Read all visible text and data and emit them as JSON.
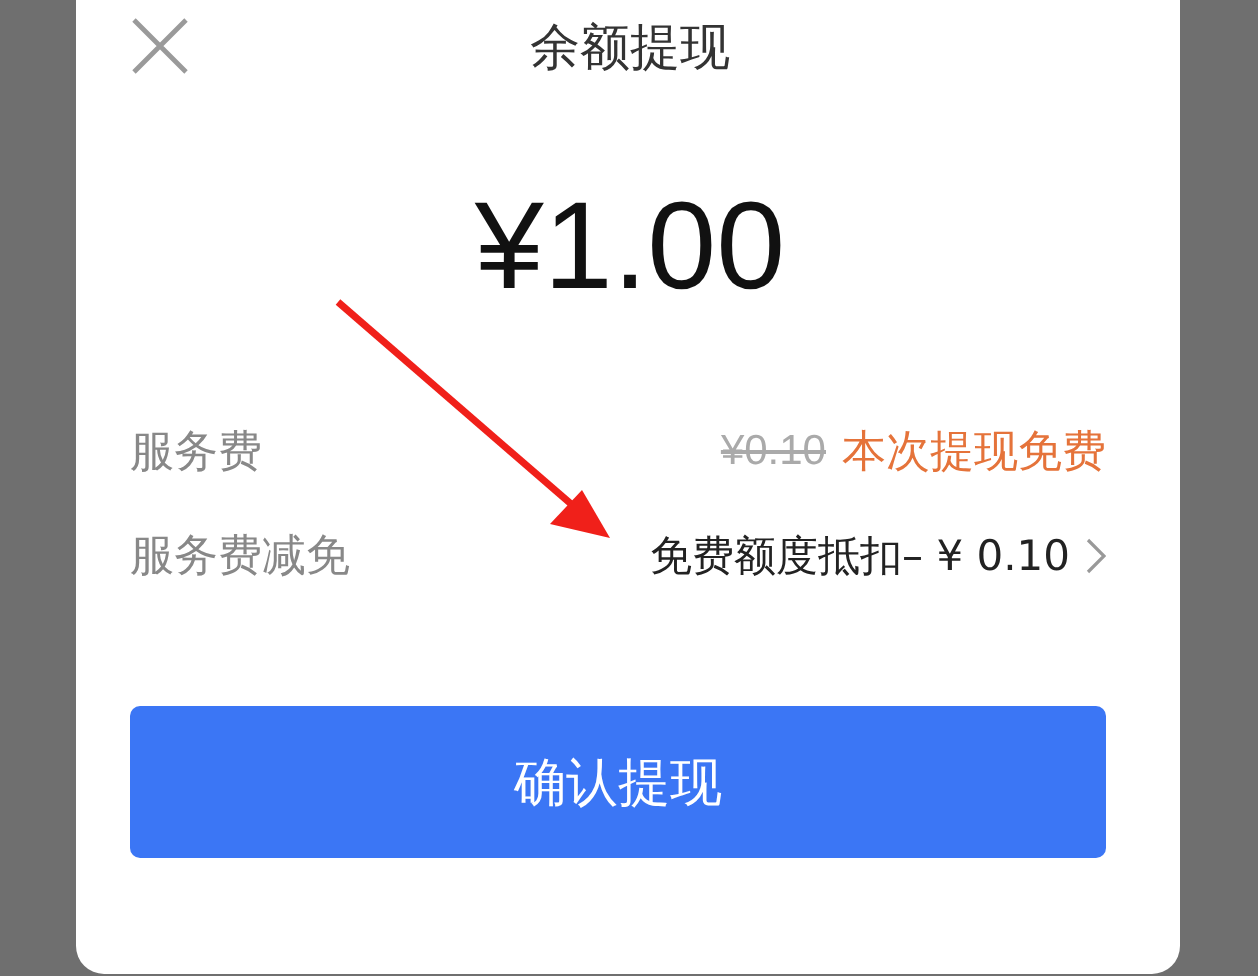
{
  "dialog": {
    "title": "余额提现",
    "amount": "¥1.00",
    "fee": {
      "label": "服务费",
      "original": "¥0.10",
      "strikethrough": true,
      "note": "本次提现免费"
    },
    "waiver": {
      "label": "服务费减免",
      "value": "免费额度抵扣– ¥ 0.10"
    },
    "confirm_button": "确认提现"
  }
}
